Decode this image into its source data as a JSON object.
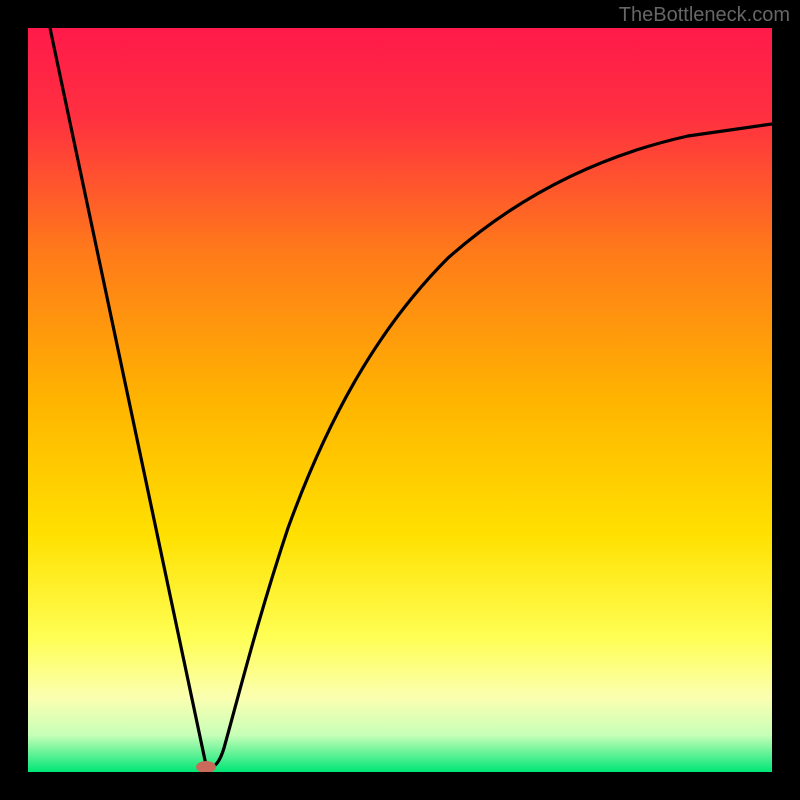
{
  "watermark": "TheBottleneck.com",
  "chart_data": {
    "type": "line",
    "title": "",
    "xlabel": "",
    "ylabel": "",
    "xlim": [
      0,
      100
    ],
    "ylim": [
      0,
      100
    ],
    "gradient_colors": {
      "top": "#ff1744",
      "mid_upper": "#ff8a00",
      "mid": "#ffd600",
      "mid_lower": "#ffff66",
      "bottom": "#00e676"
    },
    "curve_description": "V-shaped bottleneck curve: steep linear descent from top-left to minimum at ~24% along x-axis, then asymptotic rise toward upper-right.",
    "minimum_point": {
      "x": 24,
      "y": 1
    },
    "marker": {
      "x": 24,
      "y": 1,
      "color": "#c96a5a",
      "shape": "ellipse"
    },
    "series": [
      {
        "name": "bottleneck-curve",
        "points": [
          {
            "x": 3,
            "y": 100
          },
          {
            "x": 5,
            "y": 90
          },
          {
            "x": 8,
            "y": 78
          },
          {
            "x": 11,
            "y": 64
          },
          {
            "x": 14,
            "y": 50
          },
          {
            "x": 17,
            "y": 36
          },
          {
            "x": 20,
            "y": 22
          },
          {
            "x": 22,
            "y": 10
          },
          {
            "x": 24,
            "y": 1
          },
          {
            "x": 26,
            "y": 8
          },
          {
            "x": 28,
            "y": 18
          },
          {
            "x": 31,
            "y": 30
          },
          {
            "x": 35,
            "y": 42
          },
          {
            "x": 40,
            "y": 53
          },
          {
            "x": 46,
            "y": 62
          },
          {
            "x": 53,
            "y": 70
          },
          {
            "x": 61,
            "y": 76
          },
          {
            "x": 70,
            "y": 80
          },
          {
            "x": 80,
            "y": 83
          },
          {
            "x": 90,
            "y": 85
          },
          {
            "x": 100,
            "y": 86
          }
        ]
      }
    ]
  }
}
